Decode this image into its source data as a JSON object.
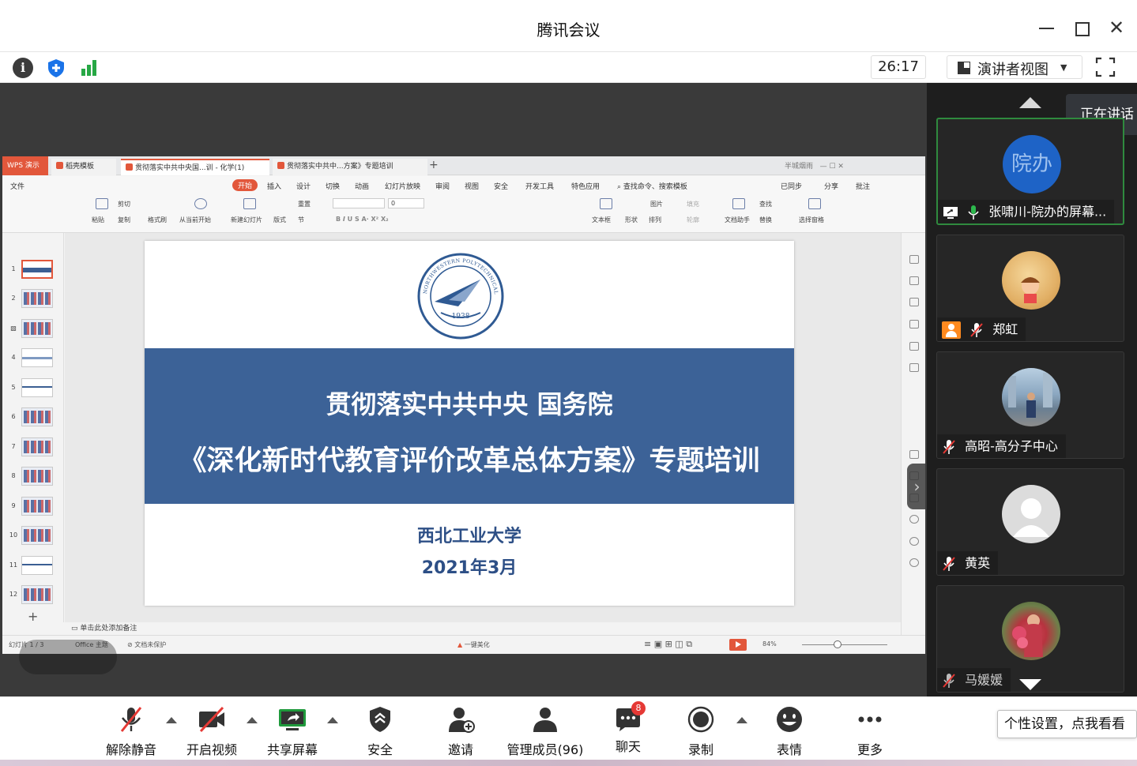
{
  "window": {
    "title": "腾讯会议"
  },
  "meeting_bar": {
    "timer": "26:17",
    "view_label": "演讲者视图"
  },
  "wps": {
    "tabs": [
      "WPS 演示",
      "稻壳模板",
      "贯彻落实中共中央国...训 - 化学(1)",
      "贯彻落实中共中...方案》专题培训"
    ],
    "ribbon_menu": [
      "文件",
      "开始",
      "插入",
      "设计",
      "切换",
      "动画",
      "幻灯片放映",
      "审阅",
      "视图",
      "安全",
      "开发工具",
      "特色应用",
      "查找命令、搜索模板"
    ],
    "ribbon_right": [
      "已同步",
      "分享",
      "批注"
    ],
    "ribbon_tools": [
      "粘贴",
      "剪切",
      "复制",
      "格式刷",
      "从当前开始",
      "新建幻灯片",
      "版式",
      "节",
      "重置",
      "文本框",
      "形状",
      "排列",
      "图片",
      "填充",
      "轮廓",
      "查找",
      "替换",
      "文档助手",
      "选择窗格"
    ],
    "top_right_user": "半城烟雨",
    "font_size_value": "0",
    "thumbnail_numbers": [
      "1",
      "2",
      "",
      "4",
      "5",
      "6",
      "7",
      "8",
      "9",
      "10",
      "11",
      "12"
    ],
    "slide": {
      "title_line1": "贯彻落实中共中央 国务院",
      "title_line2": "《深化新时代教育评价改革总体方案》专题培训",
      "organization": "西北工业大学",
      "date": "2021年3月",
      "logo_year": "1938",
      "logo_ring_text": "NORTHWESTERN POLYTECHNICAL UNIVERSITY"
    },
    "notes_placeholder": "单击此处添加备注",
    "status_left": "幻灯片 1 / 3",
    "status_theme": "Office 主题",
    "status_protect": "文档未保护",
    "status_center": "一键美化",
    "zoom": "84%",
    "colors": {
      "brand": "#e2573b",
      "slide_band": "#3c6297",
      "slide_text": "#2d4f86"
    }
  },
  "panel": {
    "speaking_label": "正在讲话",
    "participants": [
      {
        "name": "张啸川-院办的屏幕...",
        "avatar_text": "院办",
        "status": "sharing-mic-on"
      },
      {
        "name": "郑虹",
        "status": "muted"
      },
      {
        "name": "高昭-高分子中心",
        "status": "muted"
      },
      {
        "name": "黄英",
        "status": "muted"
      },
      {
        "name": "马媛媛",
        "status": "muted"
      }
    ]
  },
  "controls": {
    "unmute": "解除静音",
    "start_video": "开启视频",
    "share_screen": "共享屏幕",
    "security": "安全",
    "invite": "邀请",
    "manage_members": "管理成员(96)",
    "chat": "聊天",
    "chat_badge": "8",
    "record": "录制",
    "reactions": "表情",
    "more": "更多"
  },
  "tooltip": "个性设置，点我看看"
}
